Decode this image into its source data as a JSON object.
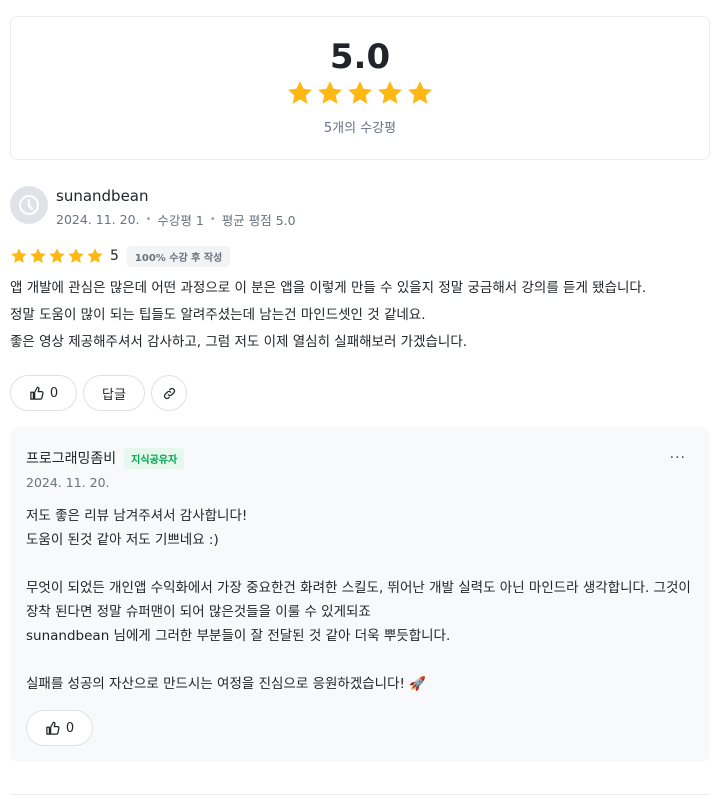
{
  "summary": {
    "score": "5.0",
    "stars": 5,
    "count_text": "5개의 수강평"
  },
  "review": {
    "author": "sunandbean",
    "date": "2024. 11. 20.",
    "course_count": "수강평 1",
    "avg_rating": "평균 평점 5.0",
    "stars": 5,
    "rating": "5",
    "badge": "100% 수강 후 작성",
    "body": [
      "앱 개발에 관심은 많은데 어떤 과정으로 이 분은 앱을 이렇게 만들 수 있을지 정말 궁금해서 강의를 듣게 됐습니다.",
      "정말 도움이 많이 되는 팁들도 알려주셨는데 남는건 마인드셋인 것 같네요.",
      "좋은 영상 제공해주셔서 감사하고, 그럼 저도 이제 열심히 실패해보러 가겠습니다."
    ]
  },
  "actions": {
    "like_count": "0",
    "reply_label": "답글"
  },
  "reply": {
    "author": "프로그래밍좀비",
    "role": "지식공유자",
    "more": "···",
    "date": "2024. 11. 20.",
    "body": "저도 좋은 리뷰 남겨주셔서 감사합니다!\n도움이 된것 같아 저도 기쁘네요 :)\n\n무엇이 되었든 개인앱 수익화에서 가장 중요한건 화려한 스킬도, 뛰어난 개발 실력도 아닌 마인드라 생각합니다. 그것이 장착 된다면 정말 슈퍼맨이 되어 많은것들을 이룰 수 있게되죠\nsunandbean 님에게 그러한 부분들이 잘 전달된 것 같아 더욱 뿌듯합니다.\n\n실패를 성공의 자산으로 만드시는 여정을 진심으로 응원하겠습니다! 🚀",
    "like_count": "0"
  },
  "colors": {
    "star": "#fdb813",
    "accent_green": "#00a650"
  }
}
